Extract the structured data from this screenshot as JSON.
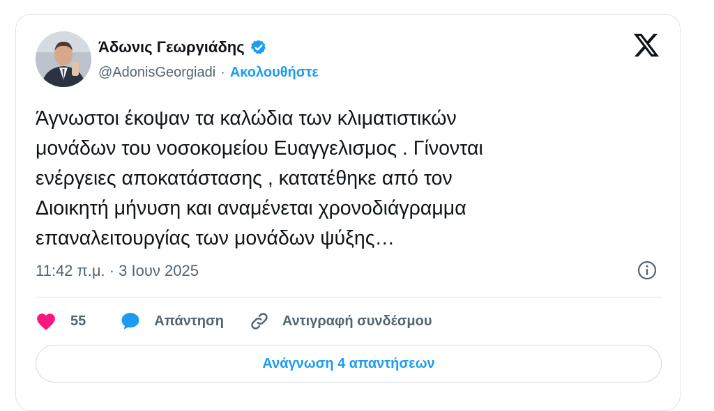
{
  "author": {
    "name": "Άδωνις Γεωργιάδης",
    "handle": "@AdonisGeorgiadi",
    "separator": "·",
    "follow_label": "Ακολουθήστε"
  },
  "tweet": {
    "text": "Άγνωστοι έκοψαν τα καλώδια των κλιματιστικών\nμονάδων του νοσοκομείου Ευαγγελισμος . Γίνονται\nενέργειες αποκατάστασης , κατατέθηκε από τον\nΔιοικητή μήνυση και αναμένεται χρονοδιάγραμμα\nεπαναλειτουργίας των μονάδων ψύξης…",
    "timestamp": "11:42 π.μ. · 3 Ιουν 2025"
  },
  "actions": {
    "like_count": "55",
    "reply_label": "Απάντηση",
    "copy_link_label": "Αντιγραφή συνδέσμου"
  },
  "read_replies_label": "Ανάγνωση 4 απαντήσεων",
  "colors": {
    "accent": "#1d9bf0",
    "like": "#f91880",
    "text": "#0f1419",
    "secondary": "#536471"
  },
  "icons": [
    "verified-badge-icon",
    "x-logo-icon",
    "info-icon",
    "heart-icon",
    "reply-bubble-icon",
    "link-icon"
  ]
}
